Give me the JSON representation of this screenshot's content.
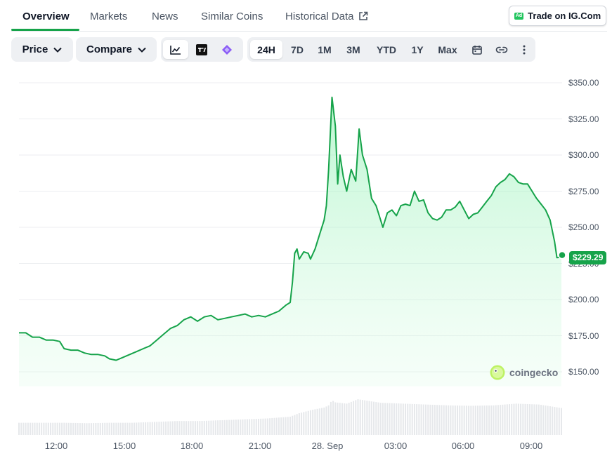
{
  "tabs": [
    {
      "label": "Overview",
      "active": true
    },
    {
      "label": "Markets",
      "active": false
    },
    {
      "label": "News",
      "active": false
    },
    {
      "label": "Similar Coins",
      "active": false
    },
    {
      "label": "Historical Data",
      "active": false
    }
  ],
  "trade_button": {
    "badge": "Ad",
    "label": "Trade on IG.Com"
  },
  "toolbar": {
    "price_dropdown": "Price",
    "compare_dropdown": "Compare",
    "chart_styles": [
      "line-chart-icon",
      "tradingview-icon",
      "diamond-chart-icon"
    ],
    "ranges": [
      "24H",
      "7D",
      "1M",
      "3M",
      "YTD",
      "1Y",
      "Max"
    ],
    "selected_range": "24H",
    "actions": [
      "calendar-icon",
      "link-icon",
      "more-vertical-icon"
    ]
  },
  "brand": "coingecko",
  "colors": {
    "accent": "#16a34a",
    "line": "#16a34a",
    "area": "#dcfce7",
    "volume": "#e5e7eb"
  },
  "chart_data": {
    "type": "area",
    "x_unit": "hours from first point (start ≈ 10:05)",
    "x_ticks": [
      {
        "x": 1.92,
        "label": "12:00"
      },
      {
        "x": 4.92,
        "label": "15:00"
      },
      {
        "x": 7.92,
        "label": "18:00"
      },
      {
        "x": 10.92,
        "label": "21:00"
      },
      {
        "x": 13.92,
        "label": "28. Sep"
      },
      {
        "x": 16.92,
        "label": "03:00"
      },
      {
        "x": 19.92,
        "label": "06:00"
      },
      {
        "x": 22.92,
        "label": "09:00"
      }
    ],
    "ylim": [
      140,
      350
    ],
    "y_ticks": [
      150,
      175,
      200,
      225,
      250,
      275,
      300,
      325,
      350
    ],
    "y_tick_labels": [
      "$150.00",
      "$175.00",
      "$200.00",
      "$225.00",
      "$250.00",
      "$275.00",
      "$300.00",
      "$325.00",
      "$350.00"
    ],
    "grid": true,
    "series": [
      {
        "values": [
          [
            0.0,
            177
          ],
          [
            0.3,
            177
          ],
          [
            0.6,
            174
          ],
          [
            0.9,
            174
          ],
          [
            1.2,
            172
          ],
          [
            1.5,
            172
          ],
          [
            1.8,
            171
          ],
          [
            2.0,
            166
          ],
          [
            2.3,
            165
          ],
          [
            2.6,
            165
          ],
          [
            2.9,
            163
          ],
          [
            3.2,
            162
          ],
          [
            3.5,
            162
          ],
          [
            3.8,
            161
          ],
          [
            4.0,
            159
          ],
          [
            4.3,
            158
          ],
          [
            4.6,
            160
          ],
          [
            4.9,
            162
          ],
          [
            5.2,
            164
          ],
          [
            5.5,
            166
          ],
          [
            5.8,
            168
          ],
          [
            6.1,
            172
          ],
          [
            6.4,
            176
          ],
          [
            6.7,
            180
          ],
          [
            7.0,
            182
          ],
          [
            7.3,
            186
          ],
          [
            7.6,
            188
          ],
          [
            7.9,
            185
          ],
          [
            8.2,
            188
          ],
          [
            8.5,
            189
          ],
          [
            8.8,
            186
          ],
          [
            9.1,
            187
          ],
          [
            9.4,
            188
          ],
          [
            9.7,
            189
          ],
          [
            10.0,
            190
          ],
          [
            10.3,
            188
          ],
          [
            10.6,
            189
          ],
          [
            10.9,
            188
          ],
          [
            11.2,
            190
          ],
          [
            11.5,
            192
          ],
          [
            11.8,
            196
          ],
          [
            12.0,
            198
          ],
          [
            12.1,
            212
          ],
          [
            12.2,
            232
          ],
          [
            12.3,
            235
          ],
          [
            12.4,
            228
          ],
          [
            12.6,
            233
          ],
          [
            12.8,
            232
          ],
          [
            12.9,
            228
          ],
          [
            13.1,
            235
          ],
          [
            13.3,
            245
          ],
          [
            13.5,
            255
          ],
          [
            13.6,
            265
          ],
          [
            13.7,
            290
          ],
          [
            13.85,
            340
          ],
          [
            14.0,
            320
          ],
          [
            14.1,
            280
          ],
          [
            14.2,
            300
          ],
          [
            14.35,
            285
          ],
          [
            14.5,
            275
          ],
          [
            14.7,
            290
          ],
          [
            14.9,
            282
          ],
          [
            15.05,
            318
          ],
          [
            15.2,
            300
          ],
          [
            15.4,
            290
          ],
          [
            15.6,
            270
          ],
          [
            15.8,
            265
          ],
          [
            15.9,
            260
          ],
          [
            16.1,
            250
          ],
          [
            16.3,
            260
          ],
          [
            16.5,
            262
          ],
          [
            16.7,
            258
          ],
          [
            16.9,
            265
          ],
          [
            17.1,
            266
          ],
          [
            17.3,
            265
          ],
          [
            17.5,
            275
          ],
          [
            17.7,
            268
          ],
          [
            17.9,
            269
          ],
          [
            18.1,
            260
          ],
          [
            18.3,
            256
          ],
          [
            18.5,
            255
          ],
          [
            18.7,
            257
          ],
          [
            18.9,
            262
          ],
          [
            19.1,
            262
          ],
          [
            19.3,
            264
          ],
          [
            19.5,
            268
          ],
          [
            19.7,
            262
          ],
          [
            19.9,
            256
          ],
          [
            20.1,
            259
          ],
          [
            20.3,
            260
          ],
          [
            20.5,
            264
          ],
          [
            20.7,
            268
          ],
          [
            20.9,
            272
          ],
          [
            21.1,
            278
          ],
          [
            21.3,
            281
          ],
          [
            21.5,
            283
          ],
          [
            21.7,
            287
          ],
          [
            21.9,
            285
          ],
          [
            22.1,
            281
          ],
          [
            22.3,
            280
          ],
          [
            22.5,
            280
          ],
          [
            22.7,
            275
          ],
          [
            22.9,
            270
          ],
          [
            23.1,
            266
          ],
          [
            23.3,
            262
          ],
          [
            23.5,
            255
          ],
          [
            23.7,
            240
          ],
          [
            23.8,
            229
          ],
          [
            24.0,
            229.29
          ]
        ]
      }
    ],
    "volume": {
      "ylim": [
        0,
        100
      ],
      "values": [
        [
          0.0,
          28
        ],
        [
          1.0,
          28
        ],
        [
          2.0,
          28
        ],
        [
          3.0,
          27
        ],
        [
          4.0,
          28
        ],
        [
          5.0,
          28
        ],
        [
          6.0,
          30
        ],
        [
          7.0,
          32
        ],
        [
          8.0,
          32
        ],
        [
          9.0,
          34
        ],
        [
          10.0,
          36
        ],
        [
          11.0,
          38
        ],
        [
          12.0,
          42
        ],
        [
          12.4,
          50
        ],
        [
          13.0,
          58
        ],
        [
          13.5,
          63
        ],
        [
          13.7,
          68
        ],
        [
          13.85,
          80
        ],
        [
          14.0,
          75
        ],
        [
          14.5,
          72
        ],
        [
          15.0,
          82
        ],
        [
          15.5,
          78
        ],
        [
          16.0,
          74
        ],
        [
          17.0,
          72
        ],
        [
          18.0,
          70
        ],
        [
          19.0,
          68
        ],
        [
          20.0,
          67
        ],
        [
          21.0,
          68
        ],
        [
          22.0,
          72
        ],
        [
          23.0,
          70
        ],
        [
          24.0,
          62
        ]
      ]
    },
    "last_price_label": "$229.29"
  }
}
